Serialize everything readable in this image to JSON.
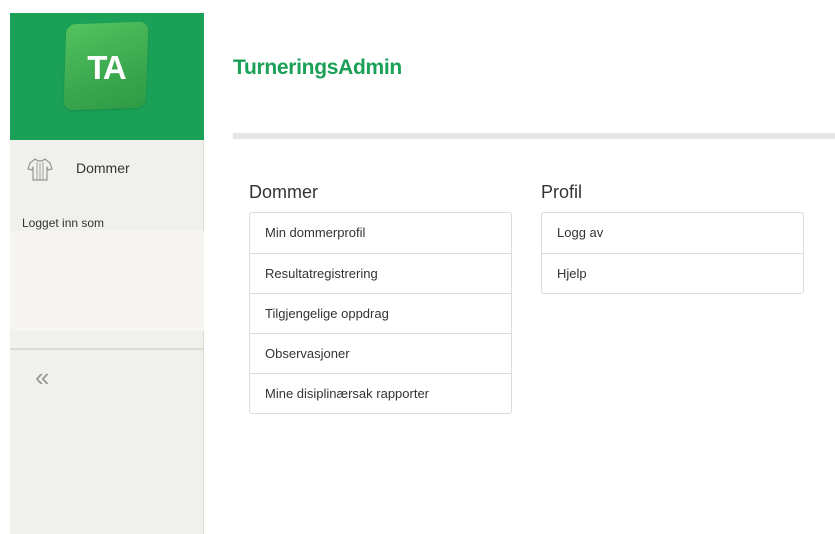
{
  "app": {
    "logo_text": "TA",
    "title": "TurneringsAdmin",
    "brand_color": "#1aa157"
  },
  "sidebar": {
    "role_icon": "shirt-icon",
    "role_label": "Dommer",
    "logged_in_label": "Logget inn som",
    "collapse_icon": "double-chevron-left-icon",
    "collapse_glyph": "«"
  },
  "panels": {
    "dommer": {
      "heading": "Dommer",
      "items": [
        "Min dommerprofil",
        "Resultatregistrering",
        "Tilgjengelige oppdrag",
        "Observasjoner",
        "Mine disiplinærsak rapporter"
      ]
    },
    "profil": {
      "heading": "Profil",
      "items": [
        "Logg av",
        "Hjelp"
      ]
    }
  }
}
